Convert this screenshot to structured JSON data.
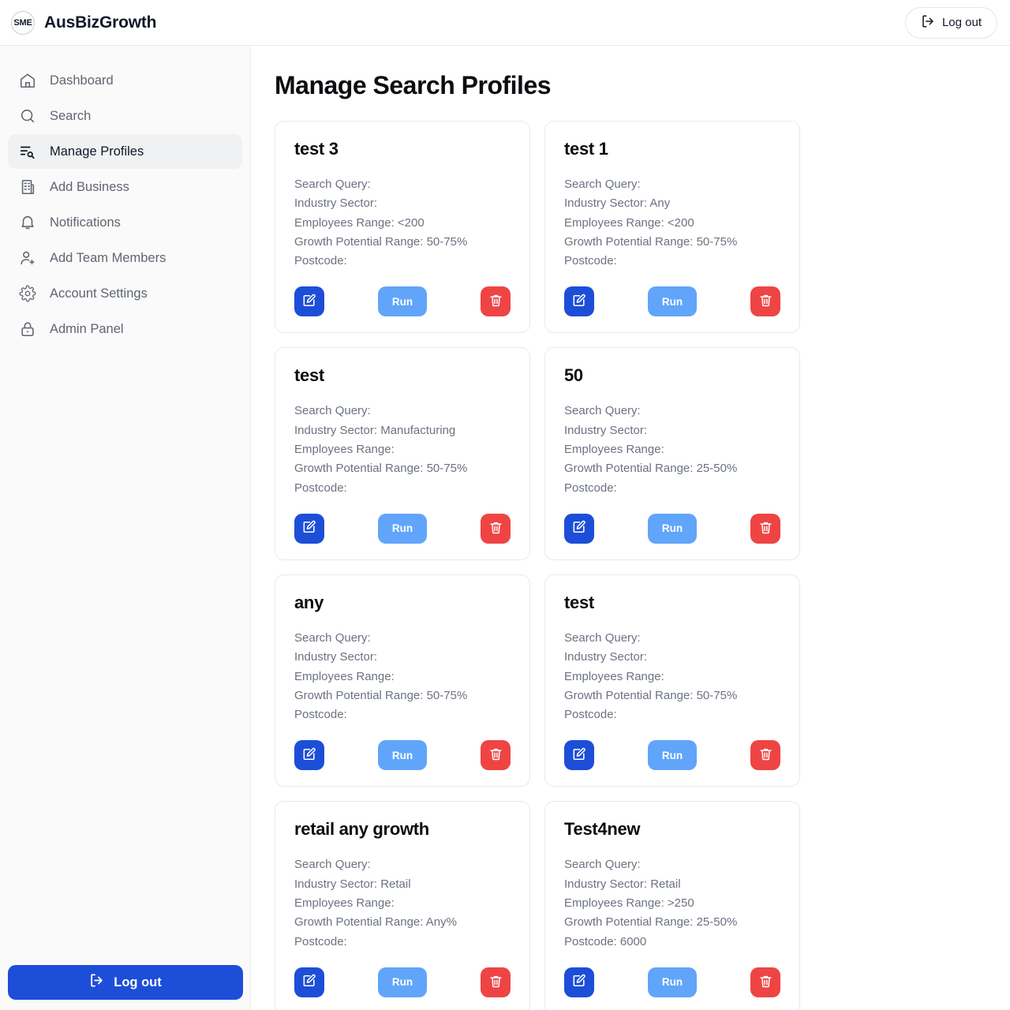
{
  "brand": {
    "logo_text": "SME",
    "name": "AusBizGrowth"
  },
  "topbar": {
    "logout_label": "Log out",
    "logout_icon": "logout-icon"
  },
  "sidebar": {
    "items": [
      {
        "label": "Dashboard",
        "icon": "home-icon",
        "active": false
      },
      {
        "label": "Search",
        "icon": "search-icon",
        "active": false
      },
      {
        "label": "Manage Profiles",
        "icon": "list-search-icon",
        "active": true
      },
      {
        "label": "Add Business",
        "icon": "building-icon",
        "active": false
      },
      {
        "label": "Notifications",
        "icon": "bell-icon",
        "active": false
      },
      {
        "label": "Add Team Members",
        "icon": "user-plus-icon",
        "active": false
      },
      {
        "label": "Account Settings",
        "icon": "gear-icon",
        "active": false
      },
      {
        "label": "Admin Panel",
        "icon": "lock-icon",
        "active": false
      }
    ],
    "logout_label": "Log out",
    "logout_icon": "logout-icon"
  },
  "main": {
    "page_title": "Manage Search Profiles",
    "labels": {
      "search_query": "Search Query:",
      "industry_sector": "Industry Sector:",
      "employees_range": "Employees Range:",
      "growth_potential_range": "Growth Potential Range:",
      "postcode": "Postcode:"
    },
    "actions": {
      "edit_icon": "edit-pencil-icon",
      "run_label": "Run",
      "delete_icon": "trash-icon"
    },
    "profiles": [
      {
        "title": "test 3",
        "search_query": "Search Query:",
        "industry_sector": "Industry Sector:",
        "employees_range": "Employees Range: <200",
        "growth_potential_range": "Growth Potential Range: 50-75%",
        "postcode": "Postcode:"
      },
      {
        "title": "test 1",
        "search_query": "Search Query:",
        "industry_sector": "Industry Sector: Any",
        "employees_range": "Employees Range: <200",
        "growth_potential_range": "Growth Potential Range: 50-75%",
        "postcode": "Postcode:"
      },
      {
        "title": "test",
        "search_query": "Search Query:",
        "industry_sector": "Industry Sector: Manufacturing",
        "employees_range": "Employees Range:",
        "growth_potential_range": "Growth Potential Range: 50-75%",
        "postcode": "Postcode:"
      },
      {
        "title": "50",
        "search_query": "Search Query:",
        "industry_sector": "Industry Sector:",
        "employees_range": "Employees Range:",
        "growth_potential_range": "Growth Potential Range: 25-50%",
        "postcode": "Postcode:"
      },
      {
        "title": "any",
        "search_query": "Search Query:",
        "industry_sector": "Industry Sector:",
        "employees_range": "Employees Range:",
        "growth_potential_range": "Growth Potential Range: 50-75%",
        "postcode": "Postcode:"
      },
      {
        "title": "test",
        "search_query": "Search Query:",
        "industry_sector": "Industry Sector:",
        "employees_range": "Employees Range:",
        "growth_potential_range": "Growth Potential Range: 50-75%",
        "postcode": "Postcode:"
      },
      {
        "title": "retail any growth",
        "search_query": "Search Query:",
        "industry_sector": "Industry Sector: Retail",
        "employees_range": "Employees Range:",
        "growth_potential_range": "Growth Potential Range: Any%",
        "postcode": "Postcode:"
      },
      {
        "title": "Test4new",
        "search_query": "Search Query:",
        "industry_sector": "Industry Sector: Retail",
        "employees_range": "Employees Range: >250",
        "growth_potential_range": "Growth Potential Range: 25-50%",
        "postcode": "Postcode: 6000"
      }
    ]
  },
  "colors": {
    "accent_blue": "#1d4ed8",
    "run_blue": "#60a5fa",
    "danger_red": "#ef4444",
    "sidebar_bg": "#fafafa",
    "muted_text": "#6b7280"
  }
}
